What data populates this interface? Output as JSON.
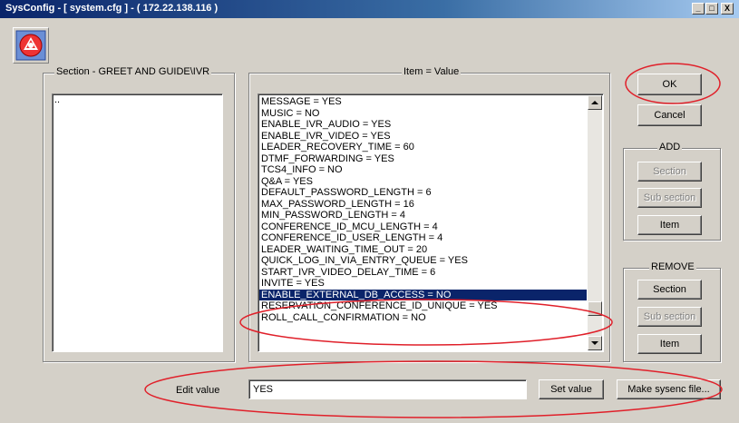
{
  "window": {
    "title": "SysConfig - [ system.cfg ] - ( 172.22.138.116 )",
    "controls": [
      "_",
      "□",
      "X"
    ]
  },
  "section_panel": {
    "label": "Section - GREET AND GUIDE\\IVR",
    "items": [
      ".."
    ]
  },
  "item_panel": {
    "label": "Item = Value",
    "items": [
      "MESSAGE = YES",
      "MUSIC = NO",
      "ENABLE_IVR_AUDIO = YES",
      "ENABLE_IVR_VIDEO = YES",
      "LEADER_RECOVERY_TIME = 60",
      "DTMF_FORWARDING = YES",
      "TCS4_INFO = NO",
      "Q&A = YES",
      "DEFAULT_PASSWORD_LENGTH = 6",
      "MAX_PASSWORD_LENGTH = 16",
      "MIN_PASSWORD_LENGTH = 4",
      "CONFERENCE_ID_MCU_LENGTH = 4",
      "CONFERENCE_ID_USER_LENGTH = 4",
      "LEADER_WAITING_TIME_OUT = 20",
      "QUICK_LOG_IN_VIA_ENTRY_QUEUE = YES",
      "START_IVR_VIDEO_DELAY_TIME = 6",
      "INVITE = YES",
      "ENABLE_EXTERNAL_DB_ACCESS = NO",
      "RESERVATION_CONFERENCE_ID_UNIQUE = YES",
      "ROLL_CALL_CONFIRMATION = NO"
    ],
    "selected_index": 17
  },
  "buttons": {
    "ok": "OK",
    "cancel": "Cancel",
    "add_group": "ADD",
    "add_section": "Section",
    "add_subsection": "Sub section",
    "add_item": "Item",
    "remove_group": "REMOVE",
    "remove_section": "Section",
    "remove_subsection": "Sub section",
    "remove_item": "Item",
    "set_value": "Set value",
    "make_sysenc": "Make sysenc file..."
  },
  "edit": {
    "label": "Edit value",
    "value": "YES"
  },
  "colors": {
    "face": "#d4d0c8",
    "selection": "#0a246a",
    "annotation": "#e0202a"
  },
  "icons": {
    "app": "app-logo-icon",
    "scroll_up": "scroll-up-arrow-icon",
    "scroll_down": "scroll-down-arrow-icon"
  }
}
